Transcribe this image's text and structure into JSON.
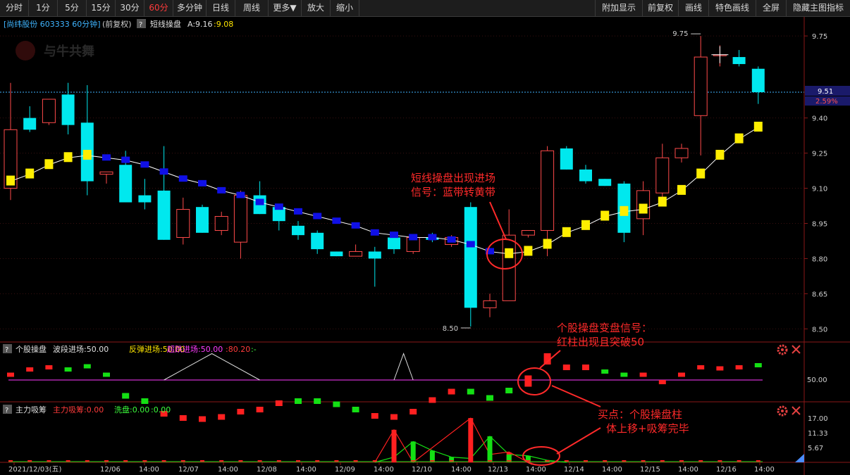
{
  "toolbar": {
    "left": [
      {
        "label": "分时",
        "w": 40
      },
      {
        "label": "1分",
        "w": 40
      },
      {
        "label": "5分",
        "w": 40
      },
      {
        "label": "15分",
        "w": 40
      },
      {
        "label": "30分",
        "w": 40
      },
      {
        "label": "60分",
        "w": 40,
        "active": true
      },
      {
        "label": "多分钟",
        "w": 46
      },
      {
        "label": "日线",
        "w": 40
      },
      {
        "label": "周线",
        "w": 46
      },
      {
        "label": "更多▼",
        "w": 46
      },
      {
        "label": "放大",
        "w": 40
      },
      {
        "label": "缩小",
        "w": 40
      }
    ],
    "right": [
      {
        "label": "附加显示",
        "w": 66
      },
      {
        "label": "前复权",
        "w": 50
      },
      {
        "label": "画线",
        "w": 42
      },
      {
        "label": "特色画线",
        "w": 66
      },
      {
        "label": "全屏",
        "w": 42
      },
      {
        "label": "隐藏主图指标",
        "w": 90
      }
    ]
  },
  "header": {
    "stock": "[尚纬股份 603333 60分钟]",
    "adj": "(前复权)",
    "q": "?",
    "indicator": "短线操盘",
    "a_val": "A:9.16",
    "b_val": ":9.08",
    "logo": "与牛共舞"
  },
  "price_axis": {
    "ticks": [
      "9.75",
      "9.40",
      "9.25",
      "9.10",
      "8.95",
      "8.80",
      "8.65",
      "8.50"
    ],
    "current": "9.51",
    "pct": "2.59%"
  },
  "markers": {
    "high": "9.75",
    "low": "8.50"
  },
  "ind1": {
    "q": "?",
    "name": "个股操盘",
    "b1": "波段进场:50.00",
    "b2": "反弹进场:50.00",
    "b3": "超跌进场:50.00",
    "b4": ":80.20",
    "b5": ":-",
    "tick": "50.00"
  },
  "ind2": {
    "q": "?",
    "name": "主力吸筹",
    "b1": "主力吸筹:0.00",
    "b2": "洗盘:0.00",
    "b3": ":0.00",
    "ticks": [
      "17.00",
      "11.33",
      "5.67"
    ]
  },
  "annotations": {
    "a1": [
      "短线操盘出现进场",
      "信号：蓝带转黄带"
    ],
    "a2": [
      "个股操盘变盘信号：",
      "红柱出现且突破50"
    ],
    "a3": [
      "买点：个股操盘柱",
      "体上移+吸筹完毕"
    ]
  },
  "xaxis": [
    {
      "label": "2021/12/03(五)",
      "x": 12
    },
    {
      "label": "12/06",
      "x": 142
    },
    {
      "label": "14:00",
      "x": 197
    },
    {
      "label": "12/07",
      "x": 253
    },
    {
      "label": "14:00",
      "x": 309
    },
    {
      "label": "12/08",
      "x": 364
    },
    {
      "label": "14:00",
      "x": 420
    },
    {
      "label": "12/09",
      "x": 475
    },
    {
      "label": "14:00",
      "x": 530
    },
    {
      "label": "12/10",
      "x": 584
    },
    {
      "label": "14:00",
      "x": 640
    },
    {
      "label": "12/13",
      "x": 692
    },
    {
      "label": "14:00",
      "x": 746
    },
    {
      "label": "12/14",
      "x": 800
    },
    {
      "label": "14:00",
      "x": 854
    },
    {
      "label": "12/15",
      "x": 908
    },
    {
      "label": "14:00",
      "x": 962
    },
    {
      "label": "12/16",
      "x": 1016
    },
    {
      "label": "14:00",
      "x": 1070
    }
  ],
  "chart_data": {
    "type": "candlestick",
    "ylim": [
      8.45,
      9.85
    ],
    "candles": [
      {
        "o": 9.1,
        "h": 9.55,
        "l": 9.05,
        "c": 9.35
      },
      {
        "o": 9.4,
        "h": 9.45,
        "l": 9.34,
        "c": 9.35
      },
      {
        "o": 9.38,
        "h": 9.48,
        "l": 9.37,
        "c": 9.48
      },
      {
        "o": 9.5,
        "h": 9.55,
        "l": 9.33,
        "c": 9.37
      },
      {
        "o": 9.38,
        "h": 9.54,
        "l": 9.07,
        "c": 9.13
      },
      {
        "o": 9.16,
        "h": 9.17,
        "l": 9.12,
        "c": 9.17
      },
      {
        "o": 9.2,
        "h": 9.26,
        "l": 9.04,
        "c": 9.04
      },
      {
        "o": 9.07,
        "h": 9.14,
        "l": 9.01,
        "c": 9.04
      },
      {
        "o": 9.09,
        "h": 9.28,
        "l": 8.88,
        "c": 8.88
      },
      {
        "o": 8.89,
        "h": 9.06,
        "l": 8.86,
        "c": 9.01
      },
      {
        "o": 9.02,
        "h": 9.03,
        "l": 8.91,
        "c": 8.91
      },
      {
        "o": 8.92,
        "h": 9.0,
        "l": 8.9,
        "c": 8.98
      },
      {
        "o": 8.87,
        "h": 9.09,
        "l": 8.8,
        "c": 9.07
      },
      {
        "o": 9.07,
        "h": 9.13,
        "l": 8.99,
        "c": 8.99
      },
      {
        "o": 9.02,
        "h": 9.03,
        "l": 8.92,
        "c": 8.96
      },
      {
        "o": 8.94,
        "h": 8.96,
        "l": 8.88,
        "c": 8.9
      },
      {
        "o": 8.91,
        "h": 8.92,
        "l": 8.82,
        "c": 8.84
      },
      {
        "o": 8.83,
        "h": 8.83,
        "l": 8.81,
        "c": 8.81
      },
      {
        "o": 8.81,
        "h": 8.86,
        "l": 8.81,
        "c": 8.83
      },
      {
        "o": 8.83,
        "h": 8.85,
        "l": 8.68,
        "c": 8.8
      },
      {
        "o": 8.89,
        "h": 8.91,
        "l": 8.82,
        "c": 8.84
      },
      {
        "o": 8.83,
        "h": 8.9,
        "l": 8.82,
        "c": 8.89
      },
      {
        "o": 8.89,
        "h": 8.91,
        "l": 8.87,
        "c": 8.88
      },
      {
        "o": 8.86,
        "h": 8.9,
        "l": 8.85,
        "c": 8.89
      },
      {
        "o": 9.02,
        "h": 9.04,
        "l": 8.51,
        "c": 8.59
      },
      {
        "o": 8.59,
        "h": 8.65,
        "l": 8.55,
        "c": 8.62
      },
      {
        "o": 8.62,
        "h": 9.01,
        "l": 8.62,
        "c": 8.9
      },
      {
        "o": 8.9,
        "h": 8.92,
        "l": 8.89,
        "c": 8.92
      },
      {
        "o": 8.92,
        "h": 9.28,
        "l": 8.81,
        "c": 9.26
      },
      {
        "o": 9.27,
        "h": 9.28,
        "l": 9.18,
        "c": 9.18
      },
      {
        "o": 9.18,
        "h": 9.2,
        "l": 9.12,
        "c": 9.13
      },
      {
        "o": 9.14,
        "h": 9.14,
        "l": 9.11,
        "c": 9.11
      },
      {
        "o": 9.12,
        "h": 9.13,
        "l": 8.87,
        "c": 8.91
      },
      {
        "o": 8.97,
        "h": 9.13,
        "l": 8.9,
        "c": 9.09
      },
      {
        "o": 9.08,
        "h": 9.29,
        "l": 9.06,
        "c": 9.23
      },
      {
        "o": 9.23,
        "h": 9.29,
        "l": 9.21,
        "c": 9.27
      },
      {
        "o": 9.41,
        "h": 9.75,
        "l": 9.24,
        "c": 9.66
      },
      {
        "o": 9.67,
        "h": 9.71,
        "l": 9.62,
        "c": 9.67
      },
      {
        "o": 9.66,
        "h": 9.69,
        "l": 9.62,
        "c": 9.63
      },
      {
        "o": 9.61,
        "h": 9.62,
        "l": 9.46,
        "c": 9.51
      }
    ],
    "ma": [
      9.13,
      9.16,
      9.2,
      9.23,
      9.24,
      9.23,
      9.22,
      9.2,
      9.17,
      9.14,
      9.12,
      9.09,
      9.07,
      9.04,
      9.02,
      9.0,
      8.98,
      8.96,
      8.94,
      8.91,
      8.9,
      8.89,
      8.89,
      8.88,
      8.86,
      8.83,
      8.82,
      8.83,
      8.86,
      8.91,
      8.94,
      8.98,
      9.0,
      9.01,
      9.04,
      9.09,
      9.16,
      9.24,
      9.31,
      9.36
    ],
    "ma_color": [
      "y",
      "y",
      "y",
      "y",
      "y",
      "b",
      "b",
      "b",
      "b",
      "b",
      "b",
      "b",
      "b",
      "b",
      "b",
      "b",
      "b",
      "b",
      "b",
      "b",
      "b",
      "b",
      "b",
      "b",
      "b",
      "b",
      "y",
      "y",
      "y",
      "y",
      "y",
      "y",
      "y",
      "y",
      "y",
      "y",
      "y",
      "y",
      "y",
      "y"
    ],
    "ind1_values": [
      55,
      60,
      62,
      60,
      63,
      55,
      35,
      30,
      18,
      14,
      13,
      15,
      20,
      22,
      28,
      30,
      30,
      27,
      22,
      16,
      15,
      20,
      31,
      39,
      39,
      33,
      40,
      49,
      70,
      62,
      62,
      58,
      55,
      55,
      48,
      55,
      62,
      61,
      62,
      64
    ],
    "ind1_red": [
      true,
      true,
      true,
      false,
      false,
      false,
      false,
      false,
      true,
      true,
      true,
      true,
      true,
      true,
      true,
      false,
      false,
      false,
      false,
      true,
      true,
      true,
      true,
      true,
      false,
      false,
      false,
      true,
      true,
      true,
      true,
      false,
      false,
      true,
      true,
      true,
      true,
      true,
      true,
      false
    ],
    "ind2_red": [
      {
        "i": 20,
        "v": 12.5
      },
      {
        "i": 24,
        "v": 17.0
      },
      {
        "i": 26,
        "v": 3.8
      }
    ],
    "ind2_green": [
      {
        "i": 21,
        "v": 8.0
      },
      {
        "i": 22,
        "v": 4.5
      },
      {
        "i": 23,
        "v": 2.0
      },
      {
        "i": 25,
        "v": 10.0
      },
      {
        "i": 26,
        "v": 3.0
      },
      {
        "i": 27,
        "v": 2.5
      },
      {
        "i": 28,
        "v": 0.8
      }
    ]
  }
}
